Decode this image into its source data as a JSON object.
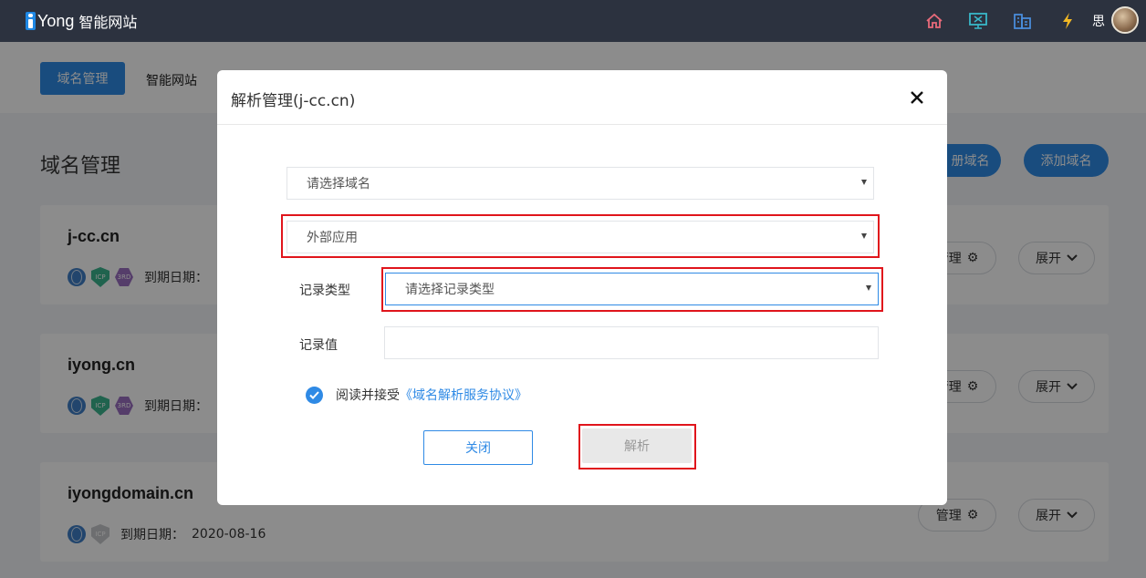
{
  "app": {
    "logo_word": "Yong",
    "logo_sub": "智能网站",
    "user_name": "思"
  },
  "colors": {
    "accent": "#2f8ae5",
    "nav_bg": "#2c323f",
    "highlight": "#e0151c"
  },
  "nav_icons": [
    "home-icon",
    "monitor-icon",
    "building-icon",
    "lightning-icon"
  ],
  "subnav": {
    "active_tab": "域名管理",
    "tab2": "智能网站"
  },
  "page": {
    "title": "域名管理",
    "register_button_partial": "册域名",
    "add_domain_button": "添加域名"
  },
  "domains": [
    {
      "name": "j-cc.cn",
      "expiry_label": "到期日期：",
      "manage": "管理",
      "expand": "展开"
    },
    {
      "name": "iyong.cn",
      "expiry_label": "到期日期：",
      "manage": "管理",
      "expand": "展开"
    },
    {
      "name": "iyongdomain.cn",
      "expiry_label": "到期日期：",
      "expiry_value": "2020-08-16",
      "manage": "管理",
      "expand": "展开"
    }
  ],
  "badges": {
    "icp": "ICP",
    "third": "3RD"
  },
  "modal": {
    "title": "解析管理(j-cc.cn)",
    "domain_select": "请选择域名",
    "app_select": "外部应用",
    "record_type_label": "记录类型",
    "record_type_select": "请选择记录类型",
    "record_value_label": "记录值",
    "record_value": "",
    "agree_text": "阅读并接受",
    "agree_link": "《域名解析服务协议》",
    "close_button": "关闭",
    "resolve_button": "解析"
  }
}
